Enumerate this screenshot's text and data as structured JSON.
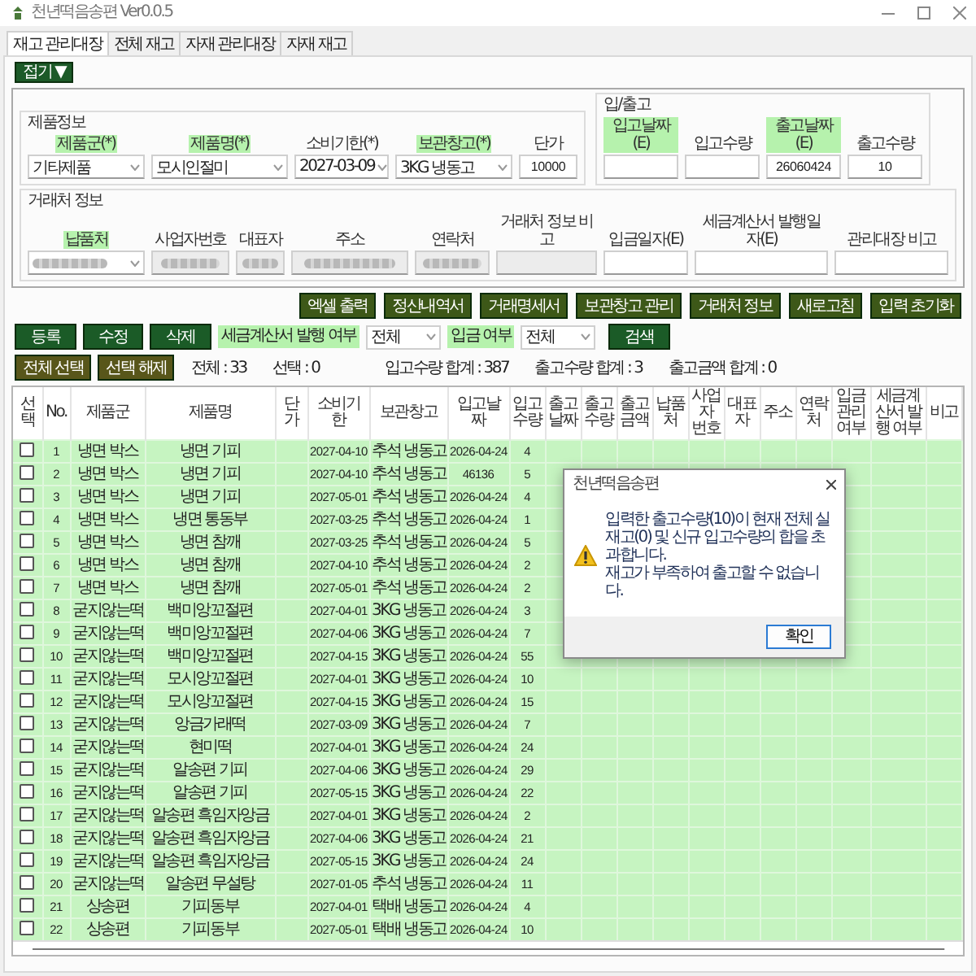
{
  "window": {
    "title": "천년떡음송편 Ver0.0.5"
  },
  "tabs": [
    {
      "label": "재고 관리대장",
      "selected": true
    },
    {
      "label": "전체 재고",
      "selected": false
    },
    {
      "label": "자재 관리대장",
      "selected": false
    },
    {
      "label": "자재 재고",
      "selected": false
    }
  ],
  "collapse_button": {
    "label": "접기 ▼"
  },
  "product_group": {
    "legend": "제품정보",
    "fields": [
      {
        "label": "제품군(*)",
        "required": true,
        "kind": "select",
        "value": "기타제품"
      },
      {
        "label": "제품명(*)",
        "required": true,
        "kind": "select",
        "value": "모시인절미"
      },
      {
        "label": "소비기한(*)",
        "required": false,
        "kind": "select",
        "value": "2027-03-09"
      },
      {
        "label": "보관창고(*)",
        "required": true,
        "kind": "select",
        "value": "3KG 냉동고"
      },
      {
        "label": "단가",
        "required": false,
        "kind": "input",
        "value": "10000"
      }
    ]
  },
  "inout_group": {
    "legend": "입/출고",
    "fields": [
      {
        "label": "입고날짜(E)",
        "required": true,
        "kind": "input"
      },
      {
        "label": "입고수량",
        "required": false,
        "kind": "input"
      },
      {
        "label": "출고날짜(E)",
        "required": true,
        "kind": "input",
        "value": "26060424"
      },
      {
        "label": "출고수량",
        "required": false,
        "kind": "input",
        "value": "10"
      }
    ]
  },
  "partner_group": {
    "legend": "거래처 정보",
    "fields": [
      {
        "label": "납품처",
        "required": true,
        "kind": "select",
        "masked": true
      },
      {
        "label": "사업자번호",
        "required": false,
        "kind": "readonly",
        "masked": true
      },
      {
        "label": "대표자",
        "required": false,
        "kind": "readonly",
        "masked": true
      },
      {
        "label": "주소",
        "required": false,
        "kind": "readonly",
        "masked": true
      },
      {
        "label": "연락처",
        "required": false,
        "kind": "readonly",
        "masked": true
      },
      {
        "label": "거래처 정보 비고",
        "required": false,
        "kind": "readonly",
        "masked": false
      },
      {
        "label": "입금일자(E)",
        "required": false,
        "kind": "input"
      },
      {
        "label": "세금계산서 발행일자(E)",
        "required": false,
        "kind": "input"
      },
      {
        "label": "관리대장 비고",
        "required": false,
        "kind": "input"
      }
    ]
  },
  "tool_buttons": [
    "엑셀 출력",
    "정산내역서",
    "거래명세서",
    "보관창고 관리",
    "거래처 정보",
    "새로고침",
    "입력 초기화"
  ],
  "edit_buttons": [
    "등록",
    "수정",
    "삭제"
  ],
  "filters": [
    {
      "label": "세금계산서 발행 여부",
      "value": "전체"
    },
    {
      "label": "입금 여부",
      "value": "전체"
    }
  ],
  "search_button": "검색",
  "selection_buttons": [
    "전체 선택",
    "선택 해제"
  ],
  "stats": [
    "전체 : 33",
    "선택 : 0",
    "입고수량 합계 : 387",
    "출고수량 합계 : 3",
    "출고금액 합계 : 0"
  ],
  "table": {
    "columns": [
      "선택",
      "No.",
      "제품군",
      "제품명",
      "단가",
      "소비기한",
      "보관창고",
      "입고날짜",
      "입고수량",
      "출고날짜",
      "출고수량",
      "출고금액",
      "납품처",
      "사업자 번호",
      "대표자",
      "주소",
      "연락처",
      "입금 관리여부",
      "세금계산서 발행 여부",
      "비고"
    ],
    "rows": [
      {
        "checked": false,
        "no": "1",
        "product_group": "냉면 박스",
        "product_name": "냉면 기피",
        "expiry_date": "2027-04-10",
        "warehouse": "추석 냉동고",
        "in_date": "2026-04-24",
        "in_qty": "4"
      },
      {
        "checked": false,
        "no": "2",
        "product_group": "냉면 박스",
        "product_name": "냉면 기피",
        "expiry_date": "2027-04-10",
        "warehouse": "추석 냉동고",
        "in_date": "46136",
        "in_qty": "5"
      },
      {
        "checked": false,
        "no": "3",
        "product_group": "냉면 박스",
        "product_name": "냉면 기피",
        "expiry_date": "2027-05-01",
        "warehouse": "추석 냉동고",
        "in_date": "2026-04-24",
        "in_qty": "4"
      },
      {
        "checked": false,
        "no": "4",
        "product_group": "냉면 박스",
        "product_name": "냉면 통동부",
        "expiry_date": "2027-03-25",
        "warehouse": "추석 냉동고",
        "in_date": "2026-04-24",
        "in_qty": "1"
      },
      {
        "checked": false,
        "no": "5",
        "product_group": "냉면 박스",
        "product_name": "냉면 참깨",
        "expiry_date": "2027-03-25",
        "warehouse": "추석 냉동고",
        "in_date": "2026-04-24",
        "in_qty": "5"
      },
      {
        "checked": false,
        "no": "6",
        "product_group": "냉면 박스",
        "product_name": "냉면 참깨",
        "expiry_date": "2027-04-10",
        "warehouse": "추석 냉동고",
        "in_date": "2026-04-24",
        "in_qty": "2"
      },
      {
        "checked": false,
        "no": "7",
        "product_group": "냉면 박스",
        "product_name": "냉면 참깨",
        "expiry_date": "2027-05-01",
        "warehouse": "추석 냉동고",
        "in_date": "2026-04-24",
        "in_qty": "2"
      },
      {
        "checked": false,
        "no": "8",
        "product_group": "굳지않는떡",
        "product_name": "백미앙꼬절편",
        "expiry_date": "2027-04-01",
        "warehouse": "3KG 냉동고",
        "in_date": "2026-04-24",
        "in_qty": "3"
      },
      {
        "checked": false,
        "no": "9",
        "product_group": "굳지않는떡",
        "product_name": "백미앙꼬절편",
        "expiry_date": "2027-04-06",
        "warehouse": "3KG 냉동고",
        "in_date": "2026-04-24",
        "in_qty": "7"
      },
      {
        "checked": false,
        "no": "10",
        "product_group": "굳지않는떡",
        "product_name": "백미앙꼬절편",
        "expiry_date": "2027-04-15",
        "warehouse": "3KG 냉동고",
        "in_date": "2026-04-24",
        "in_qty": "55"
      },
      {
        "checked": false,
        "no": "11",
        "product_group": "굳지않는떡",
        "product_name": "모시앙꼬절편",
        "expiry_date": "2027-04-01",
        "warehouse": "3KG 냉동고",
        "in_date": "2026-04-24",
        "in_qty": "10"
      },
      {
        "checked": false,
        "no": "12",
        "product_group": "굳지않는떡",
        "product_name": "모시앙꼬절편",
        "expiry_date": "2027-04-15",
        "warehouse": "3KG 냉동고",
        "in_date": "2026-04-24",
        "in_qty": "15"
      },
      {
        "checked": false,
        "no": "13",
        "product_group": "굳지않는떡",
        "product_name": "앙금가래떡",
        "expiry_date": "2027-03-09",
        "warehouse": "3KG 냉동고",
        "in_date": "2026-04-24",
        "in_qty": "7"
      },
      {
        "checked": false,
        "no": "14",
        "product_group": "굳지않는떡",
        "product_name": "현미떡",
        "expiry_date": "2027-04-01",
        "warehouse": "3KG 냉동고",
        "in_date": "2026-04-24",
        "in_qty": "24"
      },
      {
        "checked": false,
        "no": "15",
        "product_group": "굳지않는떡",
        "product_name": "알송편 기피",
        "expiry_date": "2027-04-06",
        "warehouse": "3KG 냉동고",
        "in_date": "2026-04-24",
        "in_qty": "29"
      },
      {
        "checked": false,
        "no": "16",
        "product_group": "굳지않는떡",
        "product_name": "알송편 기피",
        "expiry_date": "2027-05-15",
        "warehouse": "3KG 냉동고",
        "in_date": "2026-04-24",
        "in_qty": "22"
      },
      {
        "checked": false,
        "no": "17",
        "product_group": "굳지않는떡",
        "product_name": "알송편 흑임자앙금",
        "expiry_date": "2027-04-01",
        "warehouse": "3KG 냉동고",
        "in_date": "2026-04-24",
        "in_qty": "2"
      },
      {
        "checked": false,
        "no": "18",
        "product_group": "굳지않는떡",
        "product_name": "알송편 흑임자앙금",
        "expiry_date": "2027-04-06",
        "warehouse": "3KG 냉동고",
        "in_date": "2026-04-24",
        "in_qty": "21"
      },
      {
        "checked": false,
        "no": "19",
        "product_group": "굳지않는떡",
        "product_name": "알송편 흑임자앙금",
        "expiry_date": "2027-05-15",
        "warehouse": "3KG 냉동고",
        "in_date": "2026-04-24",
        "in_qty": "24"
      },
      {
        "checked": false,
        "no": "20",
        "product_group": "굳지않는떡",
        "product_name": "알송편 무설탕",
        "expiry_date": "2027-01-05",
        "warehouse": "추석 냉동고",
        "in_date": "2026-04-24",
        "in_qty": "11"
      },
      {
        "checked": false,
        "no": "21",
        "product_group": "상송편",
        "product_name": "기피동부",
        "expiry_date": "2027-04-01",
        "warehouse": "택배 냉동고",
        "in_date": "2026-04-24",
        "in_qty": "4"
      },
      {
        "checked": false,
        "no": "22",
        "product_group": "상송편",
        "product_name": "기피동부",
        "expiry_date": "2027-05-01",
        "warehouse": "택배 냉동고",
        "in_date": "2026-04-24",
        "in_qty": "10"
      }
    ]
  },
  "dialog": {
    "title": "천년떡음송편",
    "messages": [
      "입력한 출고수량(10)이 현재 전체 실재고(0) 및 신규 입고수량의 합을 초과합니다.",
      "재고가 부족하여 출고할 수 없습니다."
    ],
    "button": "확인"
  }
}
